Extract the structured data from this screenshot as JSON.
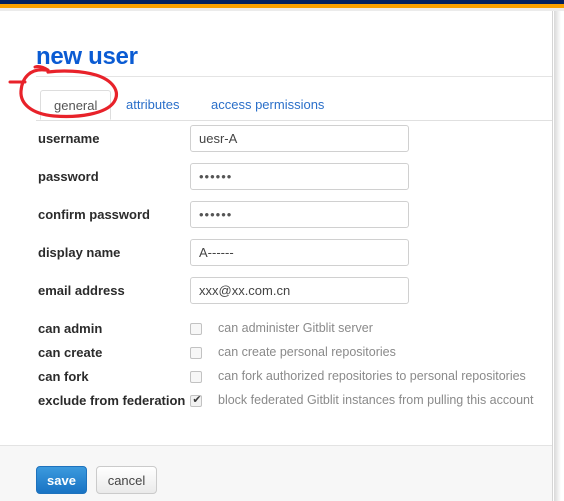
{
  "chrome": {
    "navy_color": "#002060",
    "orange_color": "#f8a000"
  },
  "page": {
    "title": "new user",
    "title_color": "#0a5bd3"
  },
  "tabs": [
    {
      "label": "general",
      "active": true
    },
    {
      "label": "attributes",
      "active": false
    },
    {
      "label": "access permissions",
      "active": false
    }
  ],
  "annotation": {
    "shape": "hand-drawn-red-ellipse",
    "color": "#e8222a",
    "targets": "general tab"
  },
  "fields": [
    {
      "label": "username",
      "value": "uesr-A",
      "masked": false
    },
    {
      "label": "password",
      "value": "••••••",
      "masked": true
    },
    {
      "label": "confirm password",
      "value": "••••••",
      "masked": true
    },
    {
      "label": "display name",
      "value": "A------",
      "masked": false
    },
    {
      "label": "email address",
      "value": "xxx@xx.com.cn",
      "masked": false
    }
  ],
  "checkboxes": [
    {
      "label": "can admin",
      "checked": false,
      "description": "can administer Gitblit server"
    },
    {
      "label": "can create",
      "checked": false,
      "description": "can create personal repositories"
    },
    {
      "label": "can fork",
      "checked": false,
      "description": "can fork authorized repositories to personal repositories"
    },
    {
      "label": "exclude from federation",
      "checked": true,
      "description": "block federated Gitblit instances from pulling this account"
    }
  ],
  "footer": {
    "save_label": "save",
    "cancel_label": "cancel",
    "save_color": "#1973c4"
  }
}
